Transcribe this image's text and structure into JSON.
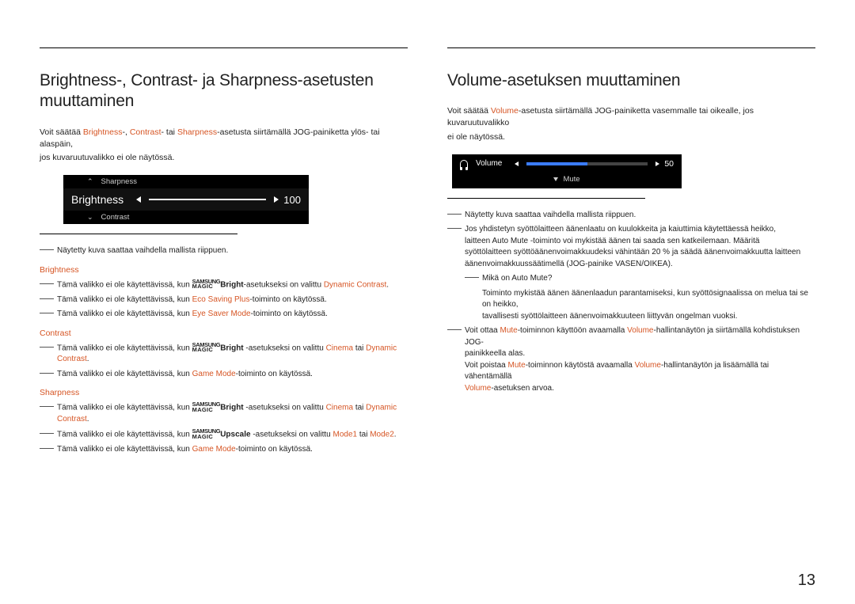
{
  "left": {
    "heading": "Brightness-, Contrast- ja Sharpness-asetusten muuttaminen",
    "intro_pre": "Voit säätää ",
    "kw1": "Brightness",
    "intro_mid1": "-, ",
    "kw2": "Contrast",
    "intro_mid2": "- tai ",
    "kw3": "Sharpness",
    "intro_post1": "-asetusta siirtämällä JOG-painiketta ylös- tai alaspäin,",
    "intro_line2": "jos kuvaruutuvalikko ei ole näytössä.",
    "osd": {
      "sharpness": "Sharpness",
      "brightness": "Brightness",
      "value": "100",
      "contrast": "Contrast"
    },
    "note_image": "Näytetty kuva saattaa vaihdella mallista riippuen.",
    "section_brightness": {
      "title": "Brightness",
      "n1": {
        "pre": "Tämä valikko ei ole käytettävissä, kun ",
        "mid": "Bright",
        "post1": "-asetukseksi on valittu ",
        "kw": "Dynamic Contrast",
        "post2": "."
      },
      "n2": {
        "pre": "Tämä valikko ei ole käytettävissä, kun ",
        "kw": "Eco Saving Plus",
        "post": "-toiminto on käytössä."
      },
      "n3": {
        "pre": "Tämä valikko ei ole käytettävissä, kun ",
        "kw": "Eye Saver Mode",
        "post": "-toiminto on käytössä."
      }
    },
    "section_contrast": {
      "title": "Contrast",
      "n1": {
        "pre": "Tämä valikko ei ole käytettävissä, kun ",
        "mid": "Bright ",
        "post1": "-asetukseksi on valittu ",
        "kw1": "Cinema",
        "mid2": " tai ",
        "kw2": "Dynamic Contrast",
        "post2": "."
      },
      "n2": {
        "pre": "Tämä valikko ei ole käytettävissä, kun ",
        "kw": "Game Mode",
        "post": "-toiminto on käytössä."
      }
    },
    "section_sharpness": {
      "title": "Sharpness",
      "n1": {
        "pre": "Tämä valikko ei ole käytettävissä, kun ",
        "mid": "Bright ",
        "post1": "-asetukseksi on valittu ",
        "kw1": "Cinema",
        "mid2": " tai ",
        "kw2": "Dynamic Contrast",
        "post2": "."
      },
      "n2": {
        "pre": "Tämä valikko ei ole käytettävissä, kun ",
        "mid": "Upscale ",
        "post1": "-asetukseksi on valittu ",
        "kw1": "Mode1",
        "mid2": " tai ",
        "kw2": "Mode2",
        "post2": "."
      },
      "n3": {
        "pre": "Tämä valikko ei ole käytettävissä, kun ",
        "kw": "Game Mode",
        "post": "-toiminto on käytössä."
      }
    }
  },
  "right": {
    "heading": "Volume-asetuksen muuttaminen",
    "intro_pre": "Voit säätää ",
    "kw": "Volume",
    "intro_post1": "-asetusta siirtämällä JOG-painiketta vasemmalle tai oikealle, jos kuvaruutuvalikko",
    "intro_line2": "ei ole näytössä.",
    "osd": {
      "volume_label": "Volume",
      "value": "50",
      "value_pct": 50,
      "mute": "Mute"
    },
    "note_image": "Näytetty kuva saattaa vaihdella mallista riippuen.",
    "n1": {
      "line1": "Jos yhdistetyn syöttölaitteen äänenlaatu on kuulokkeita ja kaiuttimia käytettäessä heikko,",
      "line2": "laitteen Auto Mute -toiminto voi mykistää äänen tai saada sen katkeilemaan. Määritä",
      "line3": "syöttölaitteen syöttöäänenvoimakkuudeksi vähintään 20 % ja säädä äänenvoimakkuutta laitteen",
      "line4": "äänenvoimakkuussäätimellä (JOG-painike VASEN/OIKEA)."
    },
    "n1_sub_q": "Mikä on Auto Mute?",
    "n1_sub_a1": "Toiminto mykistää äänen äänenlaadun parantamiseksi, kun syöttösignaalissa on melua tai se on heikko,",
    "n1_sub_a2": "tavallisesti syöttölaitteen äänenvoimakkuuteen liittyvän ongelman vuoksi.",
    "n2": {
      "pre": "Voit ottaa ",
      "kw1": "Mute",
      "mid1": "-toiminnon käyttöön avaamalla ",
      "kw2": "Volume",
      "mid2": "-hallintanäytön ja siirtämällä kohdistuksen JOG-",
      "line2_pre": "painikkeella alas.",
      "line3_pre": "Voit poistaa ",
      "line3_mid1": "-toiminnon käytöstä avaamalla ",
      "line3_mid2": "-hallintanäytön ja lisäämällä tai vähentämällä",
      "line4_kw": "Volume",
      "line4_post": "-asetuksen arvoa."
    }
  },
  "samsung_top": "SAMSUNG",
  "samsung_bot": "MAGIC",
  "page_number": "13"
}
